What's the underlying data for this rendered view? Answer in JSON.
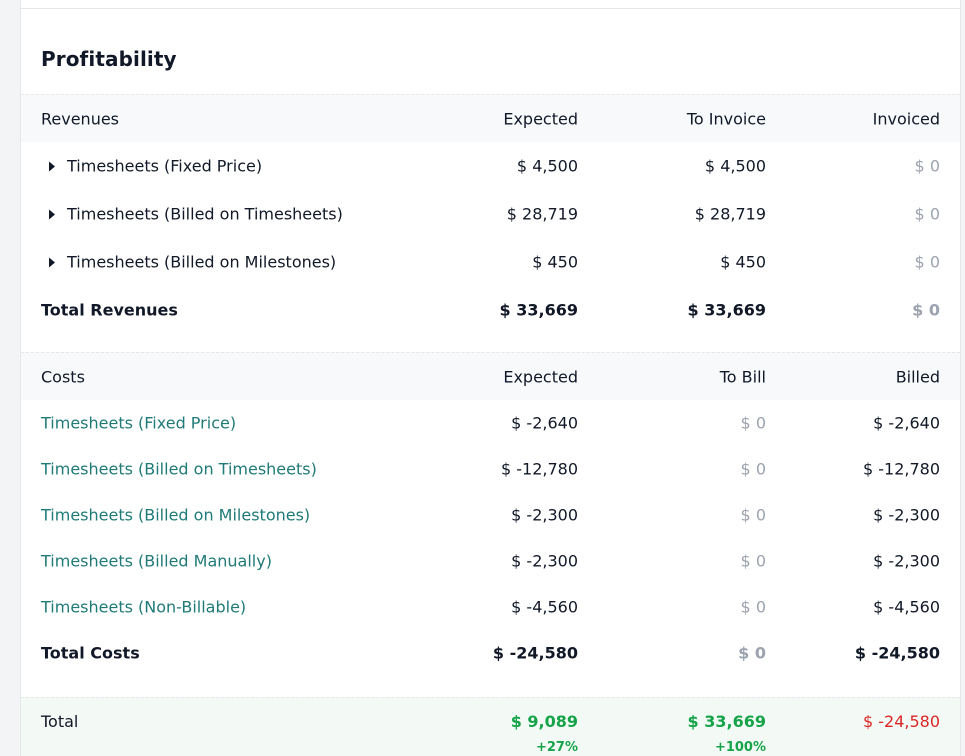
{
  "title": "Profitability",
  "revenues": {
    "header": {
      "label": "Revenues",
      "col1": "Expected",
      "col2": "To Invoice",
      "col3": "Invoiced"
    },
    "rows": [
      {
        "label": "Timesheets (Fixed Price)",
        "col1": "$ 4,500",
        "col2": "$ 4,500",
        "col3": "$ 0"
      },
      {
        "label": "Timesheets (Billed on Timesheets)",
        "col1": "$ 28,719",
        "col2": "$ 28,719",
        "col3": "$ 0"
      },
      {
        "label": "Timesheets (Billed on Milestones)",
        "col1": "$ 450",
        "col2": "$ 450",
        "col3": "$ 0"
      }
    ],
    "total": {
      "label": "Total Revenues",
      "col1": "$ 33,669",
      "col2": "$ 33,669",
      "col3": "$ 0"
    }
  },
  "costs": {
    "header": {
      "label": "Costs",
      "col1": "Expected",
      "col2": "To Bill",
      "col3": "Billed"
    },
    "rows": [
      {
        "label": "Timesheets (Fixed Price)",
        "col1": "$ -2,640",
        "col2": "$ 0",
        "col3": "$ -2,640"
      },
      {
        "label": "Timesheets (Billed on Timesheets)",
        "col1": "$ -12,780",
        "col2": "$ 0",
        "col3": "$ -12,780"
      },
      {
        "label": "Timesheets (Billed on Milestones)",
        "col1": "$ -2,300",
        "col2": "$ 0",
        "col3": "$ -2,300"
      },
      {
        "label": "Timesheets (Billed Manually)",
        "col1": "$ -2,300",
        "col2": "$ 0",
        "col3": "$ -2,300"
      },
      {
        "label": "Timesheets (Non-Billable)",
        "col1": "$ -4,560",
        "col2": "$ 0",
        "col3": "$ -4,560"
      }
    ],
    "total": {
      "label": "Total Costs",
      "col1": "$ -24,580",
      "col2": "$ 0",
      "col3": "$ -24,580"
    }
  },
  "grand_total": {
    "label": "Total",
    "col1": "$ 9,089",
    "col1_pct": "+27%",
    "col2": "$ 33,669",
    "col2_pct": "+100%",
    "col3": "$ -24,580"
  },
  "colors": {
    "link": "#1f7a78",
    "positive": "#16a34a",
    "negative": "#dc2626",
    "muted": "#9ca3af"
  }
}
